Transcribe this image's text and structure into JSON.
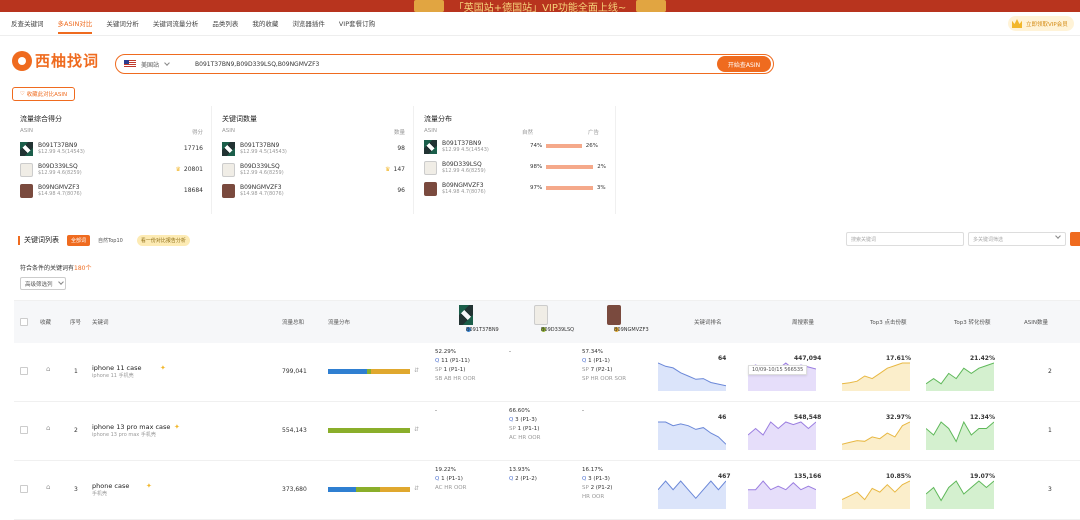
{
  "banner": {
    "text": "「英国站+德国站」VIP功能全面上线~"
  },
  "nav": {
    "items": [
      "反查关键词",
      "多ASIN对比",
      "关键词分析",
      "关键词流量分析",
      "品类列表",
      "我的收藏",
      "浏览器插件",
      "VIP套餐订购"
    ],
    "active_index": 1,
    "vip_label": "立即领取VIP会员"
  },
  "logo": {
    "text": "西柚找词"
  },
  "search": {
    "site": "美国站",
    "value": "B091T37BN9,B09D339LSQ,B09NGMVZF3",
    "button": "开始查ASIN"
  },
  "fav_button": "收藏此对比ASIN",
  "cards": [
    {
      "title": "流量综合得分",
      "col1": "ASIN",
      "col2": "得分",
      "rows": [
        {
          "asin": "B091T37BN9",
          "sub": "$12.99    4.5(14543)",
          "val": "17716",
          "crown": false
        },
        {
          "asin": "B09D339LSQ",
          "sub": "$12.99    4.6(8259)",
          "val": "20801",
          "crown": true
        },
        {
          "asin": "B09NGMVZF3",
          "sub": "$14.98    4.7(8076)",
          "val": "18684",
          "crown": false
        }
      ]
    },
    {
      "title": "关键词数量",
      "col1": "ASIN",
      "col2": "数量",
      "rows": [
        {
          "asin": "B091T37BN9",
          "sub": "$12.99    4.5(14543)",
          "val": "98",
          "crown": false
        },
        {
          "asin": "B09D339LSQ",
          "sub": "$12.99    4.6(8259)",
          "val": "147",
          "crown": true
        },
        {
          "asin": "B09NGMVZF3",
          "sub": "$14.98    4.7(8076)",
          "val": "96",
          "crown": false
        }
      ]
    },
    {
      "title": "流量分布",
      "col1": "ASIN",
      "col2": "自然",
      "col3": "广告",
      "rows": [
        {
          "asin": "B091T37BN9",
          "sub": "$12.99    4.5(14543)",
          "nat": "74%",
          "ad": "26%",
          "nat_frac": 0.74
        },
        {
          "asin": "B09D339LSQ",
          "sub": "$12.99    4.6(8259)",
          "nat": "98%",
          "ad": "2%",
          "nat_frac": 0.98
        },
        {
          "asin": "B09NGMVZF3",
          "sub": "$14.98    4.7(8076)",
          "nat": "97%",
          "ad": "3%",
          "nat_frac": 0.97
        }
      ]
    }
  ],
  "kwlist": {
    "title": "关键词列表",
    "tab_all": "全部词",
    "tab_top": "自然Top10",
    "tab_ai": "看一份对比报告分析",
    "filter1": "搜索关键词",
    "filter2": "多关键词筛选"
  },
  "count_text": "符合条件的关键词有",
  "count_val": "180个",
  "sort_dd": "高级筛选列",
  "headers": {
    "fav": "收藏",
    "no": "序号",
    "kw": "关键词",
    "vol": "流量总和",
    "share": "流量分布",
    "rank": "关键词排名",
    "search": "周搜索量",
    "top3_click": "Top3 点击份额",
    "top3_conv": "Top3 转化份额",
    "asin_cnt": "ASIN数量"
  },
  "products": [
    {
      "asin": "B091T37BN9",
      "color": "#2f7fd1"
    },
    {
      "asin": "B09D339LSQ",
      "color": "#8aae2a"
    },
    {
      "asin": "B09NGMVZF3",
      "color": "#e0a82e"
    }
  ],
  "rows": [
    {
      "no": "1",
      "kw": "iphone 11 case",
      "kw_sub": "iphone 11 手机壳",
      "vol": "799,041",
      "shares": [
        0.48,
        0.05,
        0.47
      ],
      "c1": [
        "52.29%",
        "11 (P1-11)",
        "1 (P1-1)",
        "SB AB HR OOR"
      ],
      "c2": [
        "-",
        "",
        ""
      ],
      "c3": [
        "57.34%",
        "1 (P1-1)",
        "7 (P2-1)",
        "SP HR OOR SOR"
      ],
      "rank": "64",
      "rank_vals": [
        8,
        7,
        6.5,
        5,
        4,
        3,
        3.2,
        2,
        1.5,
        1
      ],
      "search": "447,094",
      "search_vals": [
        5,
        5.2,
        5,
        5.1,
        5,
        5.3,
        5,
        5.2,
        5.1,
        5
      ],
      "tip": "10/09-10/15 566535",
      "click": "17.61%",
      "click_vals": [
        4,
        4.2,
        4.5,
        5.5,
        5,
        6,
        7,
        7.5,
        8,
        8
      ],
      "conv": "21.42%",
      "conv_vals": [
        5,
        6,
        5,
        7,
        6,
        8,
        7,
        8,
        8.5,
        9
      ],
      "asins": "2"
    },
    {
      "no": "2",
      "kw": "iphone 13 pro max case",
      "kw_sub": "iphone 13 pro max 手机壳",
      "vol": "554,143",
      "shares": [
        0,
        1,
        0
      ],
      "c1": [
        "-",
        "",
        ""
      ],
      "c2": [
        "66.60%",
        "3 (P1-3)",
        "1 (P1-1)",
        "AC HR OOR"
      ],
      "c3": [
        "-",
        "",
        ""
      ],
      "rank": "46",
      "rank_vals": [
        7,
        7,
        6,
        6.5,
        6,
        5,
        5.5,
        4,
        3,
        1
      ],
      "search": "548,548",
      "search_vals": [
        6,
        6.5,
        6,
        7,
        6.5,
        7,
        6.8,
        7,
        6.5,
        7
      ],
      "tip": "",
      "click": "32.97%",
      "click_vals": [
        3,
        3.5,
        4,
        3.8,
        5,
        4.5,
        6,
        5,
        8,
        9
      ],
      "conv": "12.34%",
      "conv_vals": [
        6,
        5,
        7,
        6,
        4,
        7,
        5,
        6,
        6,
        7
      ],
      "asins": "1"
    },
    {
      "no": "3",
      "kw": "phone case",
      "kw_sub": "手机壳",
      "vol": "373,680",
      "shares": [
        0.34,
        0.29,
        0.37
      ],
      "c1": [
        "19.22%",
        "1 (P1-1)",
        "",
        "AC HR OOR"
      ],
      "c2": [
        "13.93%",
        "2 (P1-2)",
        ""
      ],
      "c3": [
        "16.17%",
        "3 (P1-3)",
        "2 (P1-2)",
        "HR OOR"
      ],
      "rank": "467",
      "rank_vals": [
        6,
        7,
        6,
        7,
        6,
        5,
        6,
        7,
        6,
        7
      ],
      "search": "135,166",
      "search_vals": [
        6,
        6,
        6.5,
        6,
        6.2,
        6,
        6.4,
        6,
        6.2,
        6
      ],
      "tip": "",
      "click": "10.85%",
      "click_vals": [
        5,
        5.5,
        6,
        5,
        6.5,
        6,
        7,
        6,
        7,
        7.5
      ],
      "conv": "19.07%",
      "conv_vals": [
        6,
        7,
        5,
        7,
        8,
        6,
        7,
        8,
        7,
        8
      ],
      "asins": "3"
    }
  ]
}
